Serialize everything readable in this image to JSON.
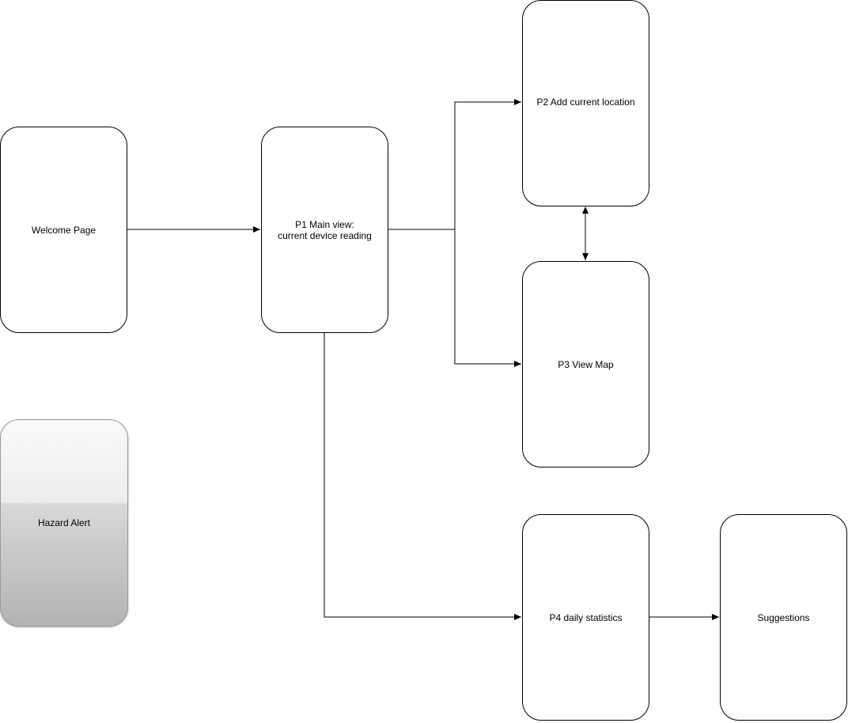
{
  "nodes": {
    "welcome": "Welcome Page",
    "p1": "P1 Main view:\ncurrent device reading",
    "p2": "P2 Add current location",
    "p3": "P3 View Map",
    "p4": "P4 daily statistics",
    "suggestions": "Suggestions",
    "hazard": "Hazard Alert"
  },
  "edges": [
    {
      "from": "Welcome Page",
      "to": "P1 Main view",
      "direction": "one-way"
    },
    {
      "from": "P1 Main view",
      "to": "P2 Add current location",
      "direction": "one-way"
    },
    {
      "from": "P1 Main view",
      "to": "P3 View Map",
      "direction": "one-way"
    },
    {
      "from": "P2 Add current location",
      "to": "P3 View Map",
      "direction": "two-way"
    },
    {
      "from": "P1 Main view",
      "to": "P4 daily statistics",
      "direction": "one-way"
    },
    {
      "from": "P4 daily statistics",
      "to": "Suggestions",
      "direction": "one-way"
    }
  ],
  "colors": {
    "stroke": "#000000",
    "background": "#ffffff",
    "hazard_gradient_top": "#fafafa",
    "hazard_gradient_bottom": "#b3b3b3"
  }
}
